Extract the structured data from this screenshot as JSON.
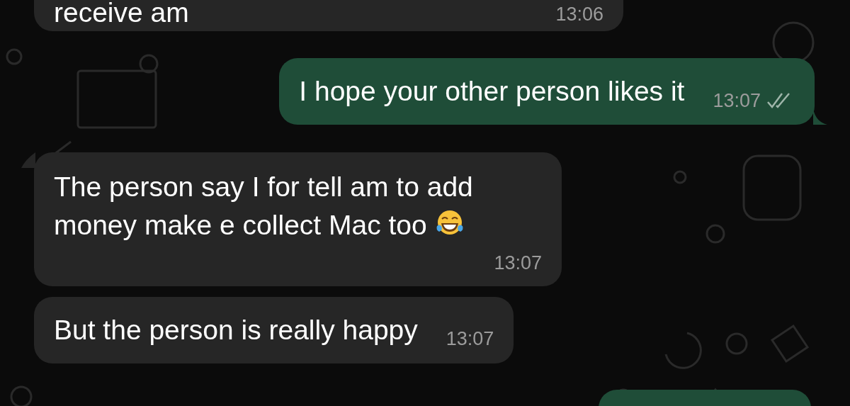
{
  "messages": [
    {
      "kind": "received",
      "text": "receive am",
      "time": "13:06"
    },
    {
      "kind": "sent",
      "text": "I hope your other person likes it",
      "time": "13:07",
      "delivered": true,
      "tail": true
    },
    {
      "kind": "received",
      "text": "The person say I for tell am to add money make e collect Mac too",
      "emoji": true,
      "time": "13:07",
      "tail": true
    },
    {
      "kind": "received",
      "text": "But the person is really happy",
      "time": "13:07"
    },
    {
      "kind": "sent"
    }
  ]
}
